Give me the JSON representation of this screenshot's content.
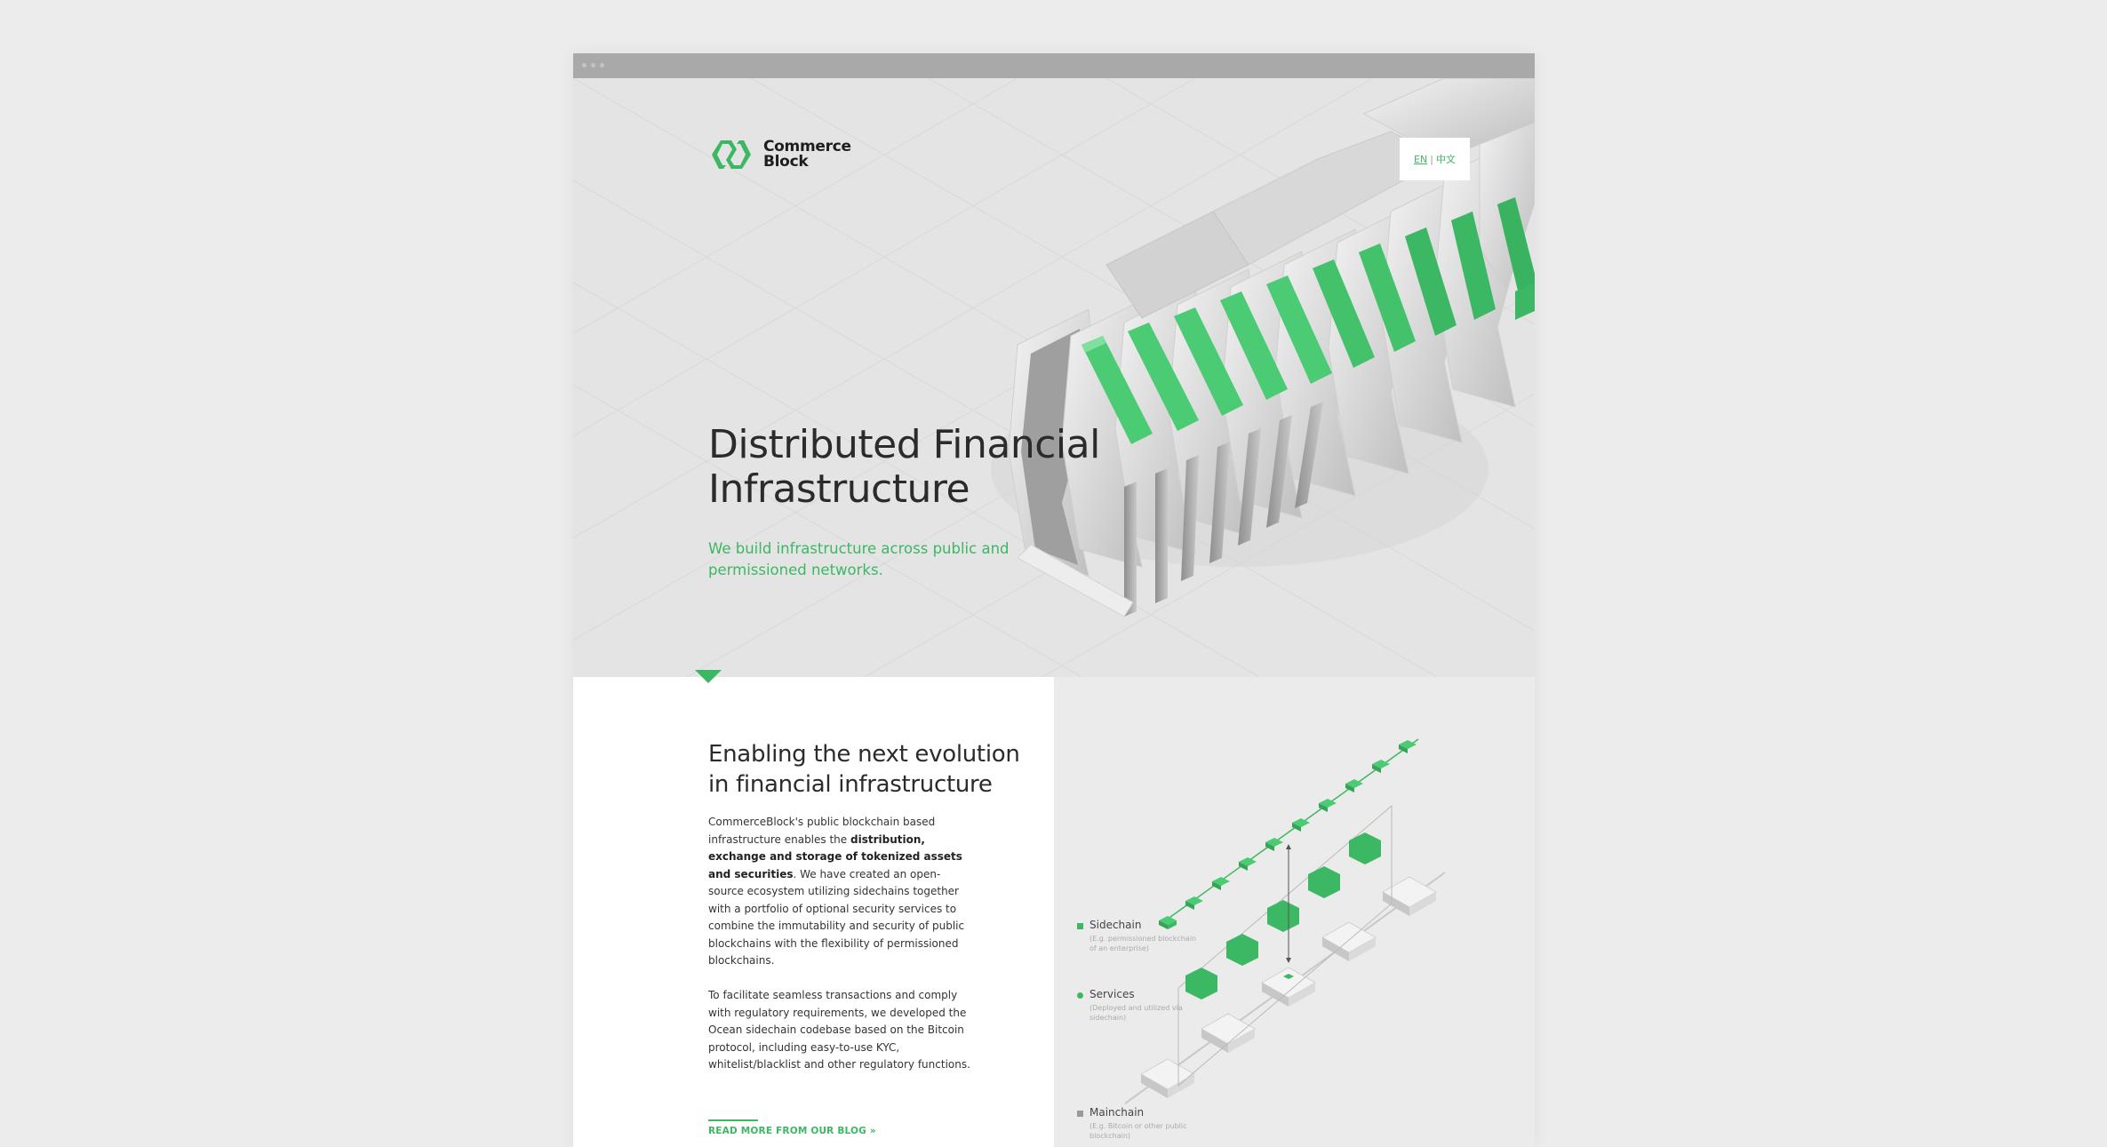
{
  "brand": {
    "name_line1": "Commerce",
    "name_line2": "Block",
    "accent": "#3cb763",
    "logo_icon": "chain-link-hexagon-icon"
  },
  "language_switch": {
    "en": "EN",
    "separator": "|",
    "zh": "中文"
  },
  "hero": {
    "title_line1": "Distributed Financial",
    "title_line2": "Infrastructure",
    "subtitle": "We build infrastructure across public and permissioned networks."
  },
  "section": {
    "title_line1": "Enabling the next evolution",
    "title_line2": "in financial infrastructure",
    "p1_start": "CommerceBlock's public blockchain based infrastructure enables the ",
    "p1_bold": "distribution, exchange and storage of tokenized assets and securities",
    "p1_end": ". We have created an open-source ecosystem utilizing sidechains together with a portfolio of optional security services to combine the immutability and security of public blockchains with the flexibility of permissioned blockchains.",
    "p2": "To facilitate seamless transactions and comply with regulatory requirements, we developed the Ocean sidechain codebase based on the Bitcoin protocol, including easy-to-use KYC, whitelist/blacklist and other regulatory functions.",
    "read_more": "READ MORE FROM OUR BLOG »"
  },
  "diagram": {
    "legend": [
      {
        "name": "Sidechain",
        "note": "(E.g. permissioned blockchain of an enterprise)",
        "color": "#3cb763",
        "shape": "square"
      },
      {
        "name": "Services",
        "note": "(Deployed and utilized via sidechain)",
        "color": "#3cb763",
        "shape": "circle"
      },
      {
        "name": "Mainchain",
        "note": "(E.g. Bitcoin or other public blockchain)",
        "color": "#9a9a9a",
        "shape": "square"
      }
    ]
  }
}
